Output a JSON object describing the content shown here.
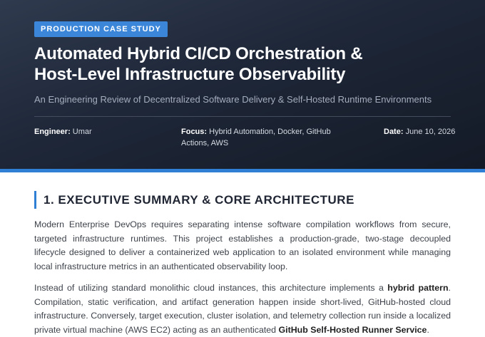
{
  "header": {
    "badge": "PRODUCTION CASE STUDY",
    "title_line1": "Automated Hybrid CI/CD Orchestration &",
    "title_line2": "Host-Level Infrastructure Observability",
    "subtitle": "An Engineering Review of Decentralized Software Delivery & Self-Hosted Runtime Environments",
    "meta": {
      "engineer_label": "Engineer:",
      "engineer_value": "Umar",
      "focus_label": "Focus:",
      "focus_value": "Hybrid Automation, Docker, GitHub Actions, AWS",
      "date_label": "Date:",
      "date_value": "June 10, 2026"
    }
  },
  "section": {
    "title": "1. EXECUTIVE SUMMARY & CORE ARCHITECTURE",
    "para1": "Modern Enterprise DevOps requires separating intense software compilation workflows from secure, targeted infrastructure runtimes. This project establishes a production-grade, two-stage decoupled lifecycle designed to deliver a containerized web application to an isolated environment while managing local infrastructure metrics in an authenticated observability loop.",
    "para2_before": "Instead of utilizing standard monolithic cloud instances, this architecture implements a ",
    "para2_bold1": "hybrid pattern",
    "para2_mid": ". Compilation, static verification, and artifact generation happen inside short-lived, GitHub-hosted cloud infrastructure. Conversely, target execution, cluster isolation, and telemetry collection run inside a localized private virtual machine (AWS EC2) acting as an authenticated ",
    "para2_bold2": "GitHub Self-Hosted Runner Service",
    "para2_after": "."
  }
}
